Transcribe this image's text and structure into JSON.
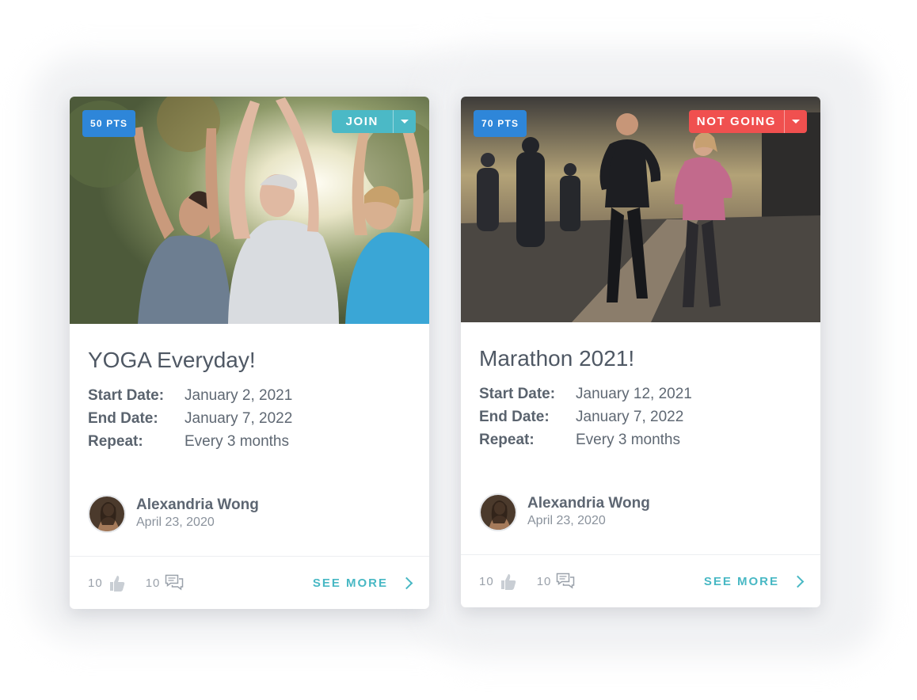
{
  "colors": {
    "points_badge": "#2e86d9",
    "join": "#4bb9c6",
    "not_going": "#f0504f",
    "see_more": "#48b8c4"
  },
  "cards": [
    {
      "points": "50 PTS",
      "rsvp_label": "JOIN",
      "rsvp_color": "#4bb9c6",
      "image": "yoga-class-photo",
      "title": "YOGA Everyday!",
      "start_label": "Start Date:",
      "start_value": "January 2, 2021",
      "end_label": "End Date:",
      "end_value": "January 7, 2022",
      "repeat_label": "Repeat:",
      "repeat_value": "Every 3 months",
      "author_name": "Alexandria Wong",
      "author_date": "April 23, 2020",
      "likes": "10",
      "comments": "10",
      "see_more": "SEE MORE"
    },
    {
      "points": "70 PTS",
      "rsvp_label": "NOT GOING",
      "rsvp_color": "#f0504f",
      "image": "marathon-runners-photo",
      "title": "Marathon 2021!",
      "start_label": "Start Date:",
      "start_value": "January 12, 2021",
      "end_label": "End Date:",
      "end_value": "January 7, 2022",
      "repeat_label": "Repeat:",
      "repeat_value": "Every 3 months",
      "author_name": "Alexandria Wong",
      "author_date": "April 23, 2020",
      "likes": "10",
      "comments": "10",
      "see_more": "SEE MORE"
    }
  ]
}
